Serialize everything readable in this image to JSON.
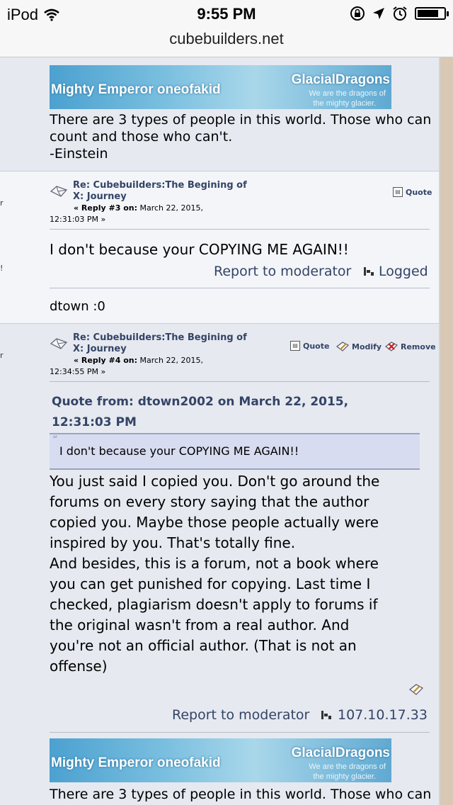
{
  "status_bar": {
    "carrier": "iPod",
    "time": "9:55 PM"
  },
  "browser": {
    "url": "cubebuilders.net"
  },
  "signature": {
    "banner_name": "Mighty Emperor oneofakid",
    "banner_group": "GlacialDragons",
    "banner_tagline_1": "We are the dragons of",
    "banner_tagline_2": "the mighty glacier.",
    "quote_lines": [
      "There are 3 types of people in this world. Those who can",
      "count and those who can't.",
      "-Einstein"
    ]
  },
  "posts": [
    {
      "title_line1": "Re: Cubebuilders:The Begining of",
      "title_line2": "X: Journey",
      "reply_label": "« Reply #3 on:",
      "date_line1": "March 22, 2015,",
      "date_line2": "12:31:03 PM »",
      "actions": [
        "Quote"
      ],
      "body": "I don't because your COPYING ME AGAIN!!",
      "report": "Report to moderator",
      "logged": "Logged",
      "signature": "dtown :0"
    },
    {
      "title_line1": "Re: Cubebuilders:The Begining of",
      "title_line2": "X: Journey",
      "reply_label": "« Reply #4 on:",
      "date_line1": "March 22, 2015,",
      "date_line2": "12:34:55 PM »",
      "actions": [
        "Quote",
        "Modify",
        "Remove"
      ],
      "quote_header_line1": "Quote from: dtown2002 on March 22, 2015,",
      "quote_header_line2": "12:31:03 PM",
      "quote_text": "I don't because your COPYING ME AGAIN!!",
      "body_lines": [
        "You just said I copied you. Don't go around the",
        "forums on every story saying that the author",
        "copied you. Maybe those people actually were",
        "inspired by you. That's totally fine.",
        "And besides, this is a forum, not a book where",
        "you can get punished for copying. Last time I",
        "checked, plagiarism doesn't apply to forums if",
        "the original wasn't from a real author. And",
        "you're not an official author. (That is not an",
        "offense)"
      ],
      "report": "Report to moderator",
      "ip": "107.10.17.33"
    }
  ],
  "bottom_signature": {
    "banner_name": "Mighty Emperor oneofakid",
    "banner_group": "GlacialDragons",
    "banner_tagline_1": "We are the dragons of",
    "banner_tagline_2": "the mighty glacier.",
    "line1": "There are 3 types of people in this world. Those who can"
  },
  "edge_marks": [
    "r",
    "!",
    "r"
  ]
}
